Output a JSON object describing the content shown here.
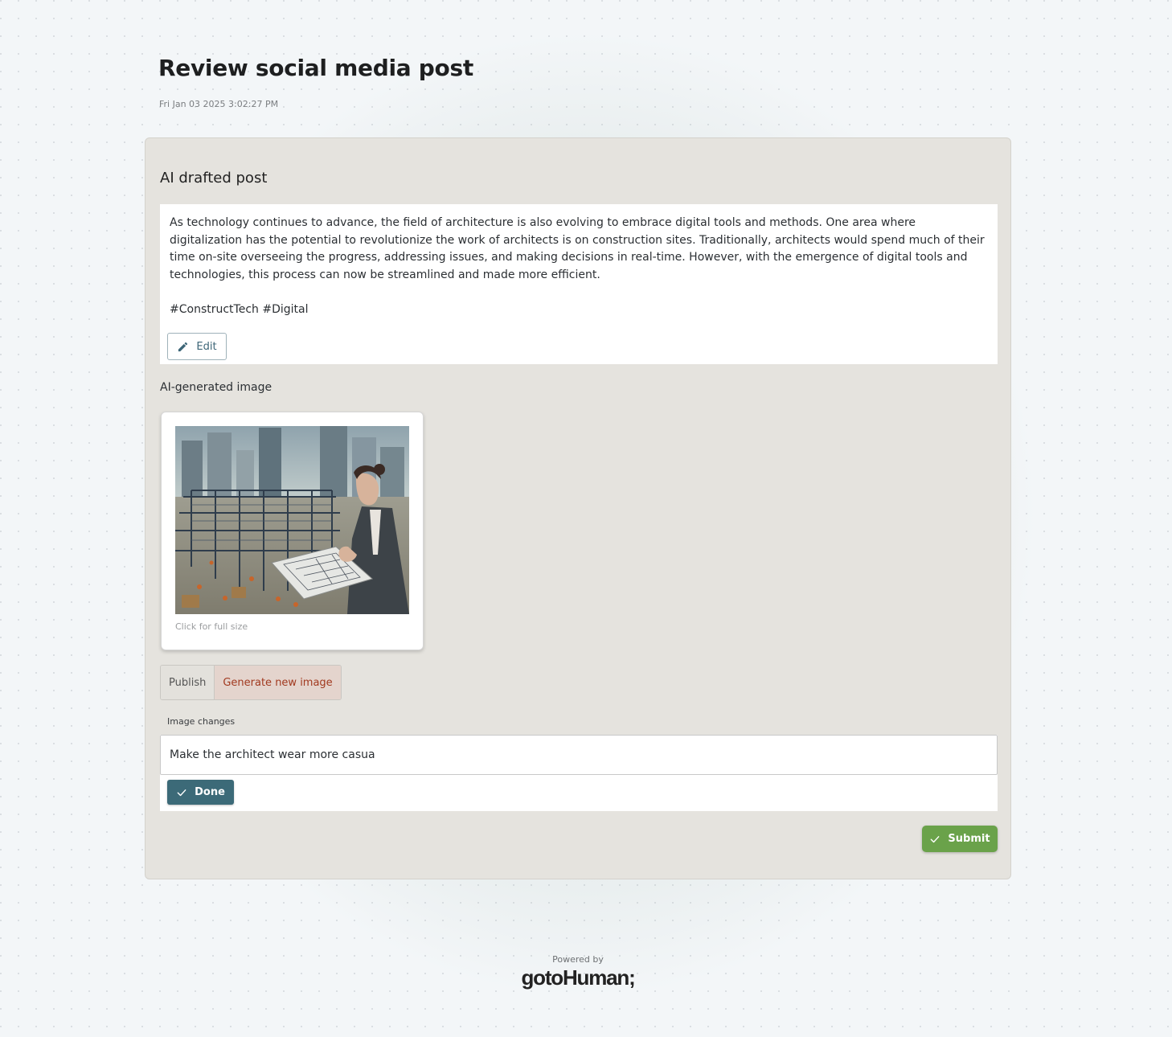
{
  "header": {
    "title": "Review social media post",
    "timestamp": "Fri Jan 03 2025 3:02:27 PM"
  },
  "post": {
    "section_title": "AI drafted post",
    "text": "As technology continues to advance, the field of architecture is also evolving to embrace digital tools and methods. One area where digitalization has the potential to revolutionize the work of architects is on construction sites. Traditionally, architects would spend much of their time on-site overseeing the progress, addressing issues, and making decisions in real-time. However, with the emergence of digital tools and technologies, this process can now be streamlined and made more efficient.\n\n#ConstructTech #Digital",
    "edit_label": "Edit"
  },
  "image": {
    "section_title": "AI-generated image",
    "caption": "Click for full size",
    "alt": "AI-generated image of an architect reviewing blueprints at a construction site"
  },
  "image_action": {
    "options": [
      "Publish",
      "Generate new image"
    ],
    "selected": "Generate new image",
    "selected_color": "#a1391f"
  },
  "image_changes": {
    "label": "Image changes",
    "value": "Make the architect wear more casua",
    "done_label": "Done"
  },
  "actions": {
    "submit_label": "Submit",
    "submit_color": "#6aa24a",
    "done_color": "#3c6a78"
  },
  "footer": {
    "powered_by": "Powered by",
    "brand": "gotoHuman;"
  }
}
